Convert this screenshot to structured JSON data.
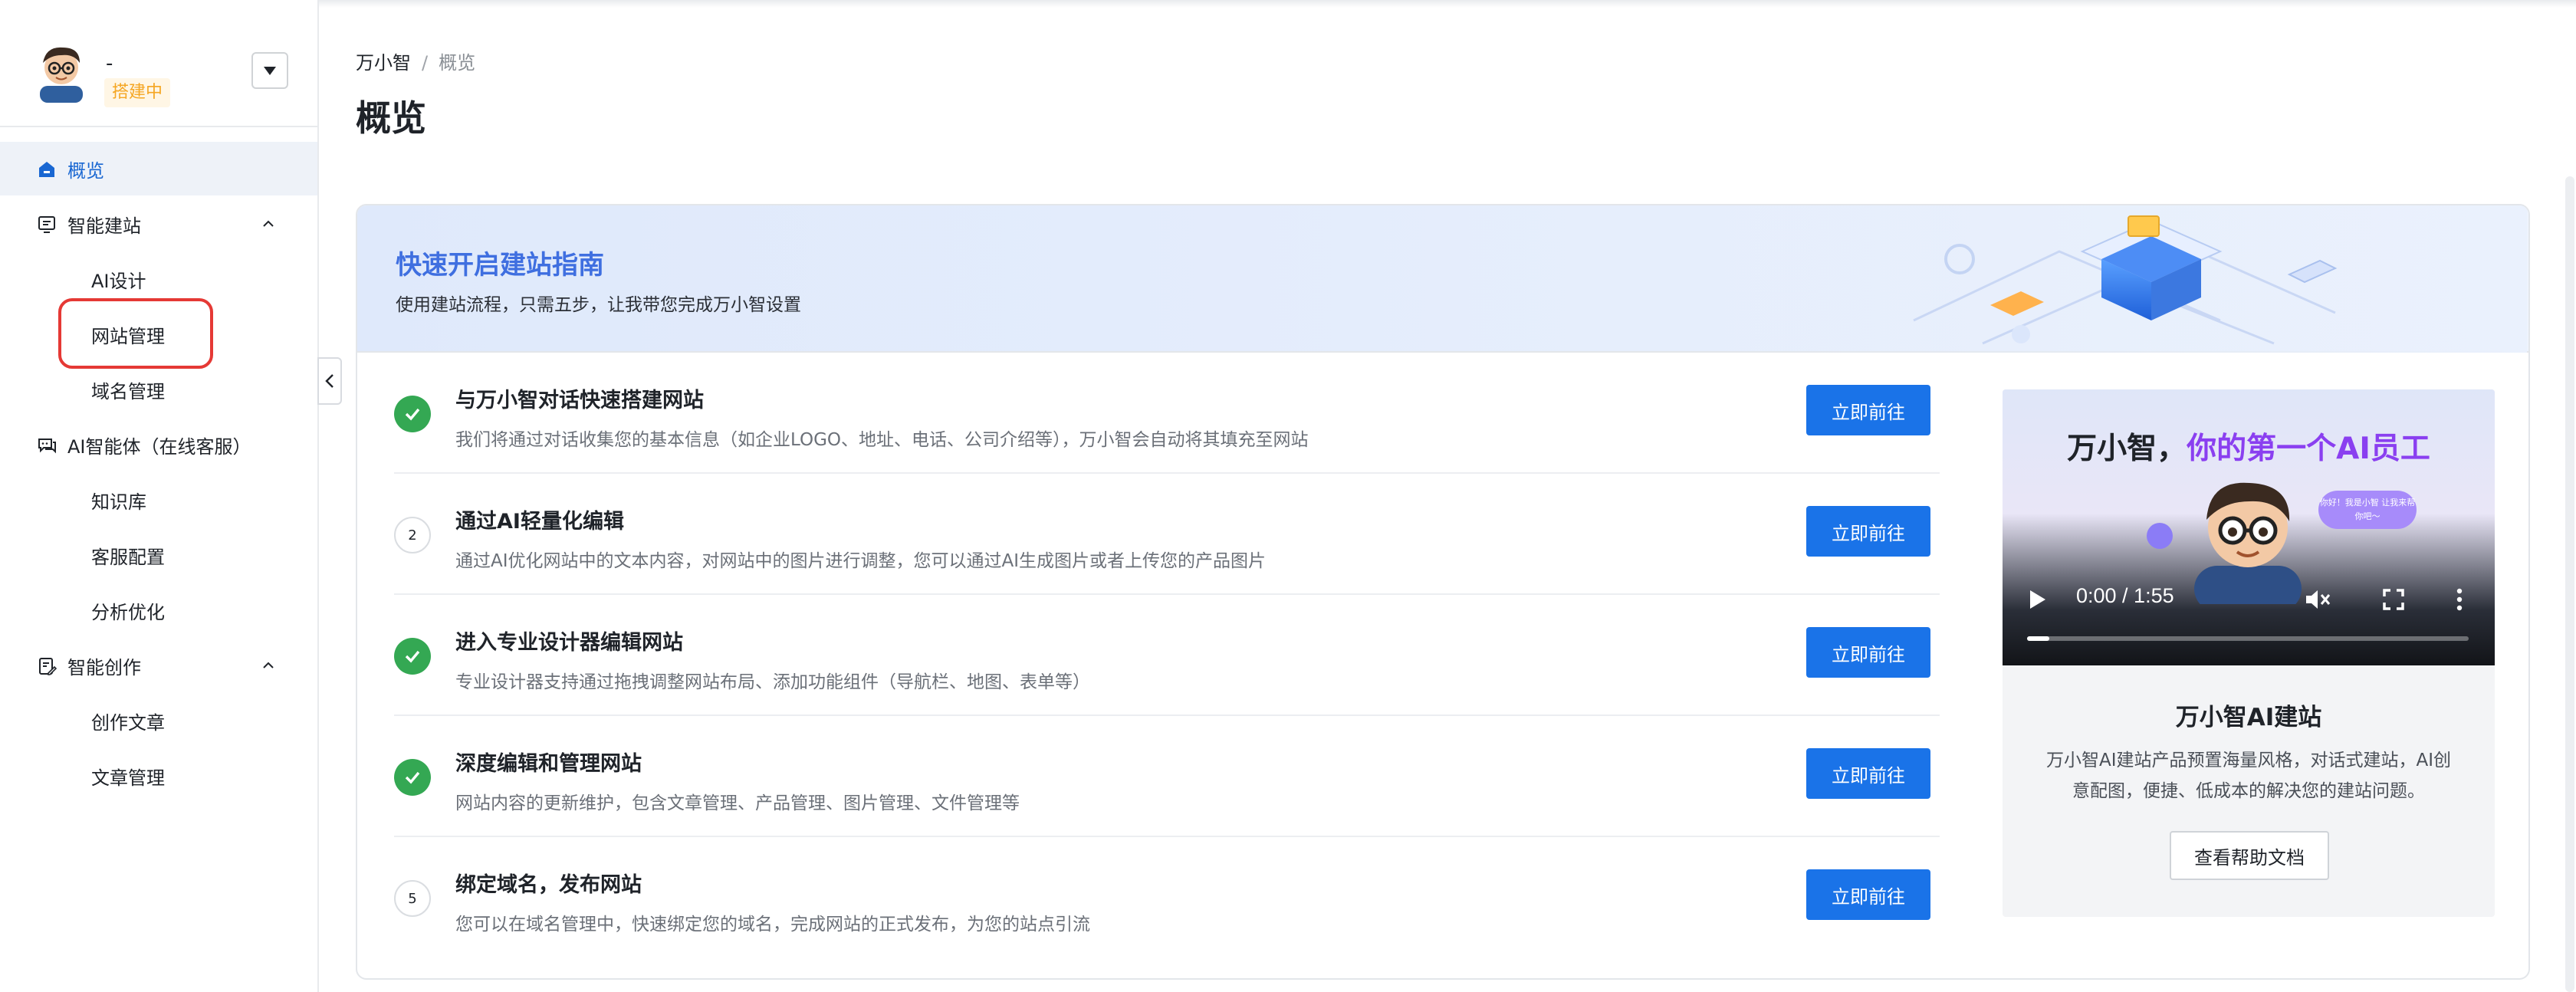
{
  "profile": {
    "name": "-",
    "status_badge": "搭建中"
  },
  "sidebar": {
    "items": [
      {
        "label": "概览",
        "icon": "home-icon",
        "active": true
      },
      {
        "label": "智能建站",
        "icon": "site-builder-icon",
        "expanded": true
      },
      {
        "label": "AI设计"
      },
      {
        "label": "网站管理",
        "highlighted": true
      },
      {
        "label": "域名管理"
      },
      {
        "label": "AI智能体（在线客服）",
        "icon": "chat-agent-icon"
      },
      {
        "label": "知识库"
      },
      {
        "label": "客服配置"
      },
      {
        "label": "分析优化"
      },
      {
        "label": "智能创作",
        "icon": "document-edit-icon",
        "expanded": true
      },
      {
        "label": "创作文章"
      },
      {
        "label": "文章管理"
      }
    ]
  },
  "breadcrumb": {
    "root": "万小智",
    "separator": "/",
    "current": "概览"
  },
  "page_title": "概览",
  "guide": {
    "title": "快速开启建站指南",
    "subtitle": "使用建站流程，只需五步，让我带您完成万小智设置",
    "steps": [
      {
        "status": "done",
        "number": "",
        "title": "与万小智对话快速搭建网站",
        "desc": "我们将通过对话收集您的基本信息（如企业LOGO、地址、电话、公司介绍等），万小智会自动将其填充至网站",
        "button": "立即前往"
      },
      {
        "status": "todo",
        "number": "2",
        "title": "通过AI轻量化编辑",
        "desc": "通过AI优化网站中的文本内容，对网站中的图片进行调整，您可以通过AI生成图片或者上传您的产品图片",
        "button": "立即前往"
      },
      {
        "status": "done",
        "number": "",
        "title": "进入专业设计器编辑网站",
        "desc": "专业设计器支持通过拖拽调整网站布局、添加功能组件（导航栏、地图、表单等）",
        "button": "立即前往"
      },
      {
        "status": "done",
        "number": "",
        "title": "深度编辑和管理网站",
        "desc": "网站内容的更新维护，包含文章管理、产品管理、图片管理、文件管理等",
        "button": "立即前往"
      },
      {
        "status": "todo",
        "number": "5",
        "title": "绑定域名，发布网站",
        "desc": "您可以在域名管理中，快速绑定您的域名，完成网站的正式发布，为您的站点引流",
        "button": "立即前往"
      }
    ]
  },
  "video_card": {
    "headline_prefix": "万小智，",
    "headline_highlight": "你的第一个AI员工",
    "speech_bubble": "你好！我是小智 让我来帮你吧～",
    "time": "0:00 / 1:55",
    "progress": 0.05,
    "title": "万小智AI建站",
    "desc": "万小智AI建站产品预置海量风格，对话式建站，AI创意配图，便捷、低成本的解决您的建站问题。",
    "help_button": "查看帮助文档"
  },
  "colors": {
    "primary": "#1a73e8",
    "success": "#34a853",
    "badge": "#f5a623",
    "highlight": "#e53935",
    "accent_purple": "#8a3ff0"
  }
}
